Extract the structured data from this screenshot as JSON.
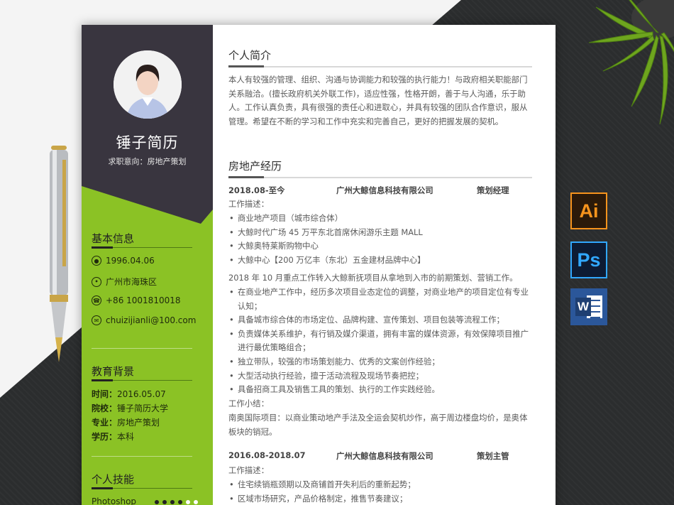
{
  "resume": {
    "name": "锤子简历",
    "intent": "求职意向：房地产策划",
    "basic": {
      "title": "基本信息",
      "items": [
        {
          "icon": "person-icon",
          "text": "1996.04.06"
        },
        {
          "icon": "location-icon",
          "text": "广州市海珠区"
        },
        {
          "icon": "phone-icon",
          "text": "+86 1001810018"
        },
        {
          "icon": "email-icon",
          "text": "chuizijianli@100.com"
        }
      ]
    },
    "education": {
      "title": "教育背景",
      "rows": [
        {
          "label": "时间：",
          "value": "2016.05.07"
        },
        {
          "label": "院校：",
          "value": "锤子简历大学"
        },
        {
          "label": "专业：",
          "value": "房地产策划"
        },
        {
          "label": "学历：",
          "value": "本科"
        }
      ]
    },
    "skills": {
      "title": "个人技能",
      "items": [
        {
          "name": "Photoshop",
          "level": 4,
          "max": 6
        }
      ]
    },
    "profile": {
      "title": "个人简介",
      "text": "本人有较强的管理、组织、沟通与协调能力和较强的执行能力！与政府相关职能部门关系融洽。(擅长政府机关外联工作)，适应性强，性格开朗，善于与人沟通，乐于助人。工作认真负责，具有很强的责任心和进取心，并具有较强的团队合作意识，服从管理。希望在不断的学习和工作中充实和完善自己，更好的把握发展的契机。"
    },
    "experience": {
      "title": "房地产经历",
      "jobs": [
        {
          "period": "2018.08-至今",
          "company": "广州大鲸信息科技有限公司",
          "position": "策划经理",
          "desc_label": "工作描述：",
          "projects": [
            "商业地产项目（城市综合体）",
            "大鲸时代广场 45 万平东北首席休闲游乐主题 MALL",
            "大鲸奥特莱斯购物中心",
            "大鲸中心【200 万亿丰（东北）五金建材品牌中心】"
          ],
          "summary_intro": "2018 年 10 月重点工作转入大鲸新抚项目从拿地到入市的前期策划、营销工作。",
          "duties": [
            "在商业地产工作中，经历多次项目业态定位的调整，对商业地产的项目定位有专业认知；",
            "具备城市综合体的市场定位、品牌构建、宣传策划、项目包装等流程工作；",
            "负责媒体关系维护，有行销及媒介渠道，拥有丰富的媒体资源，有效保障项目推广进行最优策略组合；",
            "独立带队，较强的市场策划能力、优秀的文案创作经验；",
            "大型活动执行经验，擅于活动流程及现场节奏把控；",
            "具备招商工具及销售工具的策划、执行的工作实践经验。"
          ],
          "result_label": "工作小结：",
          "result_text": "南奥国际项目：以商业策动地产手法及全运会契机炒作，高于周边楼盘均价，是奥体板块的销冠。"
        },
        {
          "period": "2016.08-2018.07",
          "company": "广州大鲸信息科技有限公司",
          "position": "策划主管",
          "desc_label": "工作描述：",
          "duties": [
            "住宅续销瓶颈期以及商铺首开失利后的重新起势；",
            "区域市场研究，产品价格制定，推售节奏建议；"
          ]
        }
      ]
    }
  },
  "software_icons": [
    {
      "label": "Ai",
      "color": "#f7941d"
    },
    {
      "label": "Ps",
      "color": "#31a8ff"
    },
    {
      "label": "W",
      "color": "#2b579a"
    }
  ]
}
